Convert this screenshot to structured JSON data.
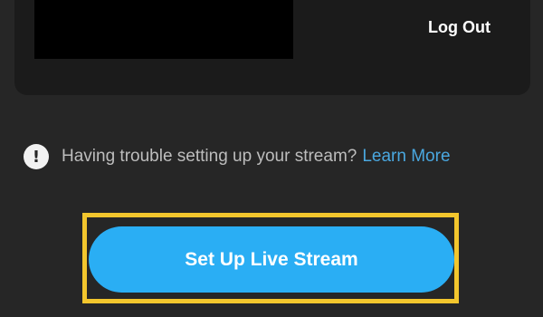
{
  "account": {
    "logout_label": "Log Out"
  },
  "help": {
    "icon": "exclamation-circle-icon",
    "icon_glyph": "!",
    "message": "Having trouble setting up your stream?",
    "link_label": "Learn More"
  },
  "actions": {
    "primary_label": "Set Up Live Stream"
  },
  "colors": {
    "background": "#262626",
    "card": "#1b1b1b",
    "accent": "#2aaef4",
    "link": "#4aa8e0",
    "highlight": "#f3c62d"
  }
}
